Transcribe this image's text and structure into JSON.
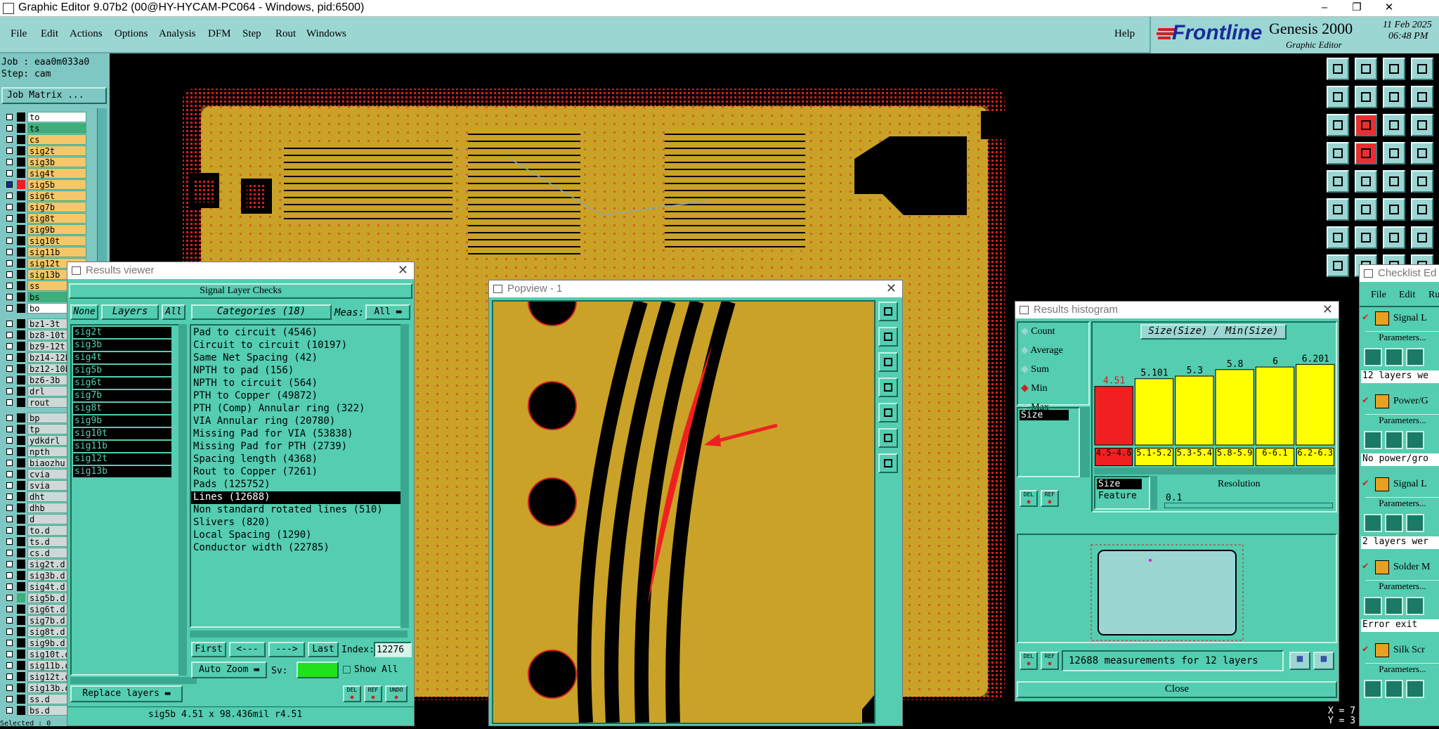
{
  "titlebar": {
    "title": "Graphic Editor 9.07b2 (00@HY-HYCAM-PC064 - Windows, pid:6500)",
    "min": "–",
    "restore": "❐",
    "close": "✕"
  },
  "menu": {
    "items": [
      "File",
      "Edit",
      "Actions",
      "Options",
      "Analysis",
      "DFM",
      "Step",
      "Rout",
      "Windows"
    ],
    "help": "Help"
  },
  "logo": {
    "brand": "Frontline",
    "product": "Genesis 2000",
    "subtitle": "Graphic Editor",
    "date": "11 Feb 2025",
    "time": "06:48 PM"
  },
  "job": {
    "job": "Job : eaa0m033a0",
    "step": "Step: cam",
    "matrix_button": "Job Matrix ..."
  },
  "layers": [
    {
      "name": "to",
      "color": "#ffffff",
      "mark": ""
    },
    {
      "name": "ts",
      "color": "#3fae7a",
      "mark": ""
    },
    {
      "name": "cs",
      "color": "#f5c768",
      "mark": ""
    },
    {
      "name": "sig2t",
      "color": "#f5c768",
      "mark": ""
    },
    {
      "name": "sig3b",
      "color": "#f5c768",
      "mark": ""
    },
    {
      "name": "sig4t",
      "color": "#f5c768",
      "mark": ""
    },
    {
      "name": "sig5b",
      "color": "#f5c768",
      "mark": "active"
    },
    {
      "name": "sig6t",
      "color": "#f5c768",
      "mark": ""
    },
    {
      "name": "sig7b",
      "color": "#f5c768",
      "mark": ""
    },
    {
      "name": "sig8t",
      "color": "#f5c768",
      "mark": ""
    },
    {
      "name": "sig9b",
      "color": "#f5c768",
      "mark": ""
    },
    {
      "name": "sig10t",
      "color": "#f5c768",
      "mark": ""
    },
    {
      "name": "sig11b",
      "color": "#f5c768",
      "mark": ""
    },
    {
      "name": "sig12t",
      "color": "#f5c768",
      "mark": ""
    },
    {
      "name": "sig13b",
      "color": "#f5c768",
      "mark": ""
    },
    {
      "name": "ss",
      "color": "#f5c768",
      "mark": ""
    },
    {
      "name": "bs",
      "color": "#3fae7a",
      "mark": ""
    },
    {
      "name": "bo",
      "color": "#ffffff",
      "mark": ""
    },
    {
      "name": "bz1-3t",
      "color": "#cfd8d8",
      "mark": ""
    },
    {
      "name": "bz8-10t",
      "color": "#cfd8d8",
      "mark": ""
    },
    {
      "name": "bz9-12t",
      "color": "#cfd8d8",
      "mark": ""
    },
    {
      "name": "bz14-12b",
      "color": "#cfd8d8",
      "mark": ""
    },
    {
      "name": "bz12-10b",
      "color": "#cfd8d8",
      "mark": ""
    },
    {
      "name": "bz6-3b",
      "color": "#cfd8d8",
      "mark": ""
    },
    {
      "name": "drl",
      "color": "#cfd8d8",
      "mark": ""
    },
    {
      "name": "rout",
      "color": "#cfd8d8",
      "mark": ""
    },
    {
      "name": "bp",
      "color": "#cfd8d8",
      "mark": ""
    },
    {
      "name": "tp",
      "color": "#cfd8d8",
      "mark": ""
    },
    {
      "name": "ydkdrl",
      "color": "#cfd8d8",
      "mark": ""
    },
    {
      "name": "npth",
      "color": "#cfd8d8",
      "mark": ""
    },
    {
      "name": "biaozhu",
      "color": "#cfd8d8",
      "mark": ""
    },
    {
      "name": "cvia",
      "color": "#cfd8d8",
      "mark": ""
    },
    {
      "name": "svia",
      "color": "#cfd8d8",
      "mark": ""
    },
    {
      "name": "dht",
      "color": "#cfd8d8",
      "mark": ""
    },
    {
      "name": "dhb",
      "color": "#cfd8d8",
      "mark": ""
    },
    {
      "name": "d",
      "color": "#cfd8d8",
      "mark": ""
    },
    {
      "name": "to.d",
      "color": "#cfd8d8",
      "mark": ""
    },
    {
      "name": "ts.d",
      "color": "#cfd8d8",
      "mark": ""
    },
    {
      "name": "cs.d",
      "color": "#cfd8d8",
      "mark": ""
    },
    {
      "name": "sig2t.d",
      "color": "#cfd8d8",
      "mark": ""
    },
    {
      "name": "sig3b.d",
      "color": "#cfd8d8",
      "mark": ""
    },
    {
      "name": "sig4t.d",
      "color": "#cfd8d8",
      "mark": ""
    },
    {
      "name": "sig5b.d",
      "color": "#cfd8d8",
      "mark": "green"
    },
    {
      "name": "sig6t.d",
      "color": "#cfd8d8",
      "mark": ""
    },
    {
      "name": "sig7b.d",
      "color": "#cfd8d8",
      "mark": ""
    },
    {
      "name": "sig8t.d",
      "color": "#cfd8d8",
      "mark": ""
    },
    {
      "name": "sig9b.d",
      "color": "#cfd8d8",
      "mark": ""
    },
    {
      "name": "sig10t.d",
      "color": "#cfd8d8",
      "mark": ""
    },
    {
      "name": "sig11b.d",
      "color": "#cfd8d8",
      "mark": ""
    },
    {
      "name": "sig12t.d",
      "color": "#cfd8d8",
      "mark": ""
    },
    {
      "name": "sig13b.d",
      "color": "#cfd8d8",
      "mark": ""
    },
    {
      "name": "ss.d",
      "color": "#cfd8d8",
      "mark": ""
    },
    {
      "name": "bs.d",
      "color": "#cfd8d8",
      "mark": ""
    }
  ],
  "selected": "Selected : 0",
  "results_viewer": {
    "title": "Results viewer",
    "header": "Signal Layer Checks",
    "none": "None",
    "layers_label": "Layers",
    "all": "All",
    "layer_list": [
      "sig2t",
      "sig3b",
      "sig4t",
      "sig5b",
      "sig6t",
      "sig7b",
      "sig8t",
      "sig9b",
      "sig10t",
      "sig11b",
      "sig12t",
      "sig13b"
    ],
    "categories_label": "Categories (18)",
    "meas_label": "Meas:",
    "meas_value": "All",
    "categories": [
      "Pad to circuit (4546)",
      "Circuit to circuit (10197)",
      "Same Net Spacing (42)",
      "NPTH to pad (156)",
      "NPTH to circuit (564)",
      "PTH to Copper (49872)",
      "PTH (Comp) Annular ring (322)",
      "VIA Annular ring (20780)",
      "Missing Pad for VIA (53838)",
      "Missing Pad for PTH (2739)",
      "Spacing length (4368)",
      "Rout to Copper (7261)",
      "Pads (125752)",
      "Lines (12688)",
      "Non standard rotated lines (510)",
      "Slivers (820)",
      "Local Spacing (1290)",
      "Conductor width (22785)"
    ],
    "selected_category": "Lines (12688)",
    "first": "First",
    "prev": "<---",
    "next": "--->",
    "last": "Last",
    "index_label": "Index:",
    "index_value": "12276",
    "auto_zoom": "Auto Zoom",
    "sv_label": "Sv:",
    "show_all": "Show All",
    "replace_layers": "Replace layers",
    "status": "sig5b  4.51 x 98.436mil  r4.51",
    "icon_labels": [
      "DEL",
      "REF",
      "UNDO"
    ]
  },
  "popview": {
    "title": "Popview - 1"
  },
  "histogram": {
    "title": "Results histogram",
    "chart_title": "Size(Size) / Min(Size)",
    "options": [
      "Count",
      "Average",
      "Sum",
      "Min",
      "Max"
    ],
    "selected_option": "Min",
    "list_item": "Size",
    "bars": [
      {
        "label": "4.5-4.6",
        "value": 4.51,
        "value_label": "4.51",
        "color": "#f02020"
      },
      {
        "label": "5.1-5.2",
        "value": 5.101,
        "value_label": "5.101",
        "color": "#ffff00"
      },
      {
        "label": "5.3-5.4",
        "value": 5.3,
        "value_label": "5.3",
        "color": "#ffff00"
      },
      {
        "label": "5.8-5.9",
        "value": 5.8,
        "value_label": "5.8",
        "color": "#ffff00"
      },
      {
        "label": "6-6.1",
        "value": 6,
        "value_label": "6",
        "color": "#ffff00"
      },
      {
        "label": "6.2-6.3",
        "value": 6.201,
        "value_label": "6.201",
        "color": "#ffff00"
      }
    ],
    "axis_list": [
      "Size",
      "Feature"
    ],
    "resolution_label": "Resolution",
    "resolution_value": "0.1",
    "measurements": "12688 measurements for 12 layers",
    "close": "Close",
    "icon_labels": [
      "DEL",
      "REF"
    ]
  },
  "checklist": {
    "title": "Checklist Ed",
    "menu": [
      "File",
      "Edit",
      "Ru"
    ],
    "items": [
      {
        "name": "Signal L",
        "params": "Parameters...",
        "note": "12 layers we"
      },
      {
        "name": "Power/G",
        "params": "Parameters...",
        "note": "No power/gro"
      },
      {
        "name": "Signal L",
        "params": "Parameters...",
        "note": "2 layers wer"
      },
      {
        "name": "Solder M",
        "params": "Parameters...",
        "note": "Error exit"
      },
      {
        "name": "Silk Scr",
        "params": "Parameters...",
        "note": ""
      }
    ]
  },
  "coords": {
    "x": "X = 7",
    "y": "Y = 3"
  },
  "colors": {
    "ui": "#54cdb0",
    "menu": "#9bd6d3",
    "copper": "#c9a227",
    "highlight": "#f02020",
    "hist_bar": "#ffff00"
  }
}
